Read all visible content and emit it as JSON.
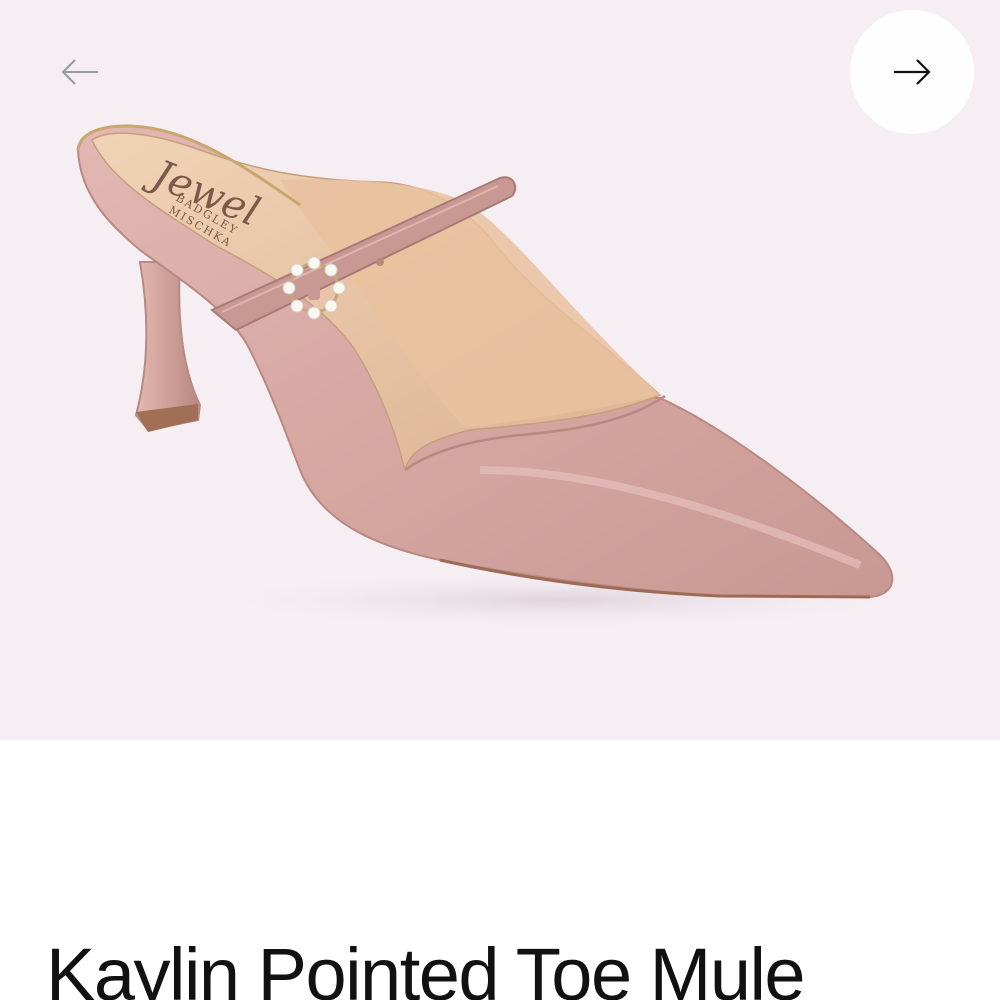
{
  "gallery": {
    "image": {
      "alt_name": "pink-satin-pointed-toe-mule",
      "insole_brand": [
        "Jewel",
        "BADGLEY",
        "MISCHKA"
      ]
    },
    "prev_icon": "arrow-left-icon",
    "next_icon": "arrow-right-icon",
    "colors": {
      "background": "#f5eef3",
      "satin": "#d6a9a4",
      "insole": "#e8c4a2"
    }
  },
  "product": {
    "title": "Kaylin Pointed Toe Mule"
  }
}
